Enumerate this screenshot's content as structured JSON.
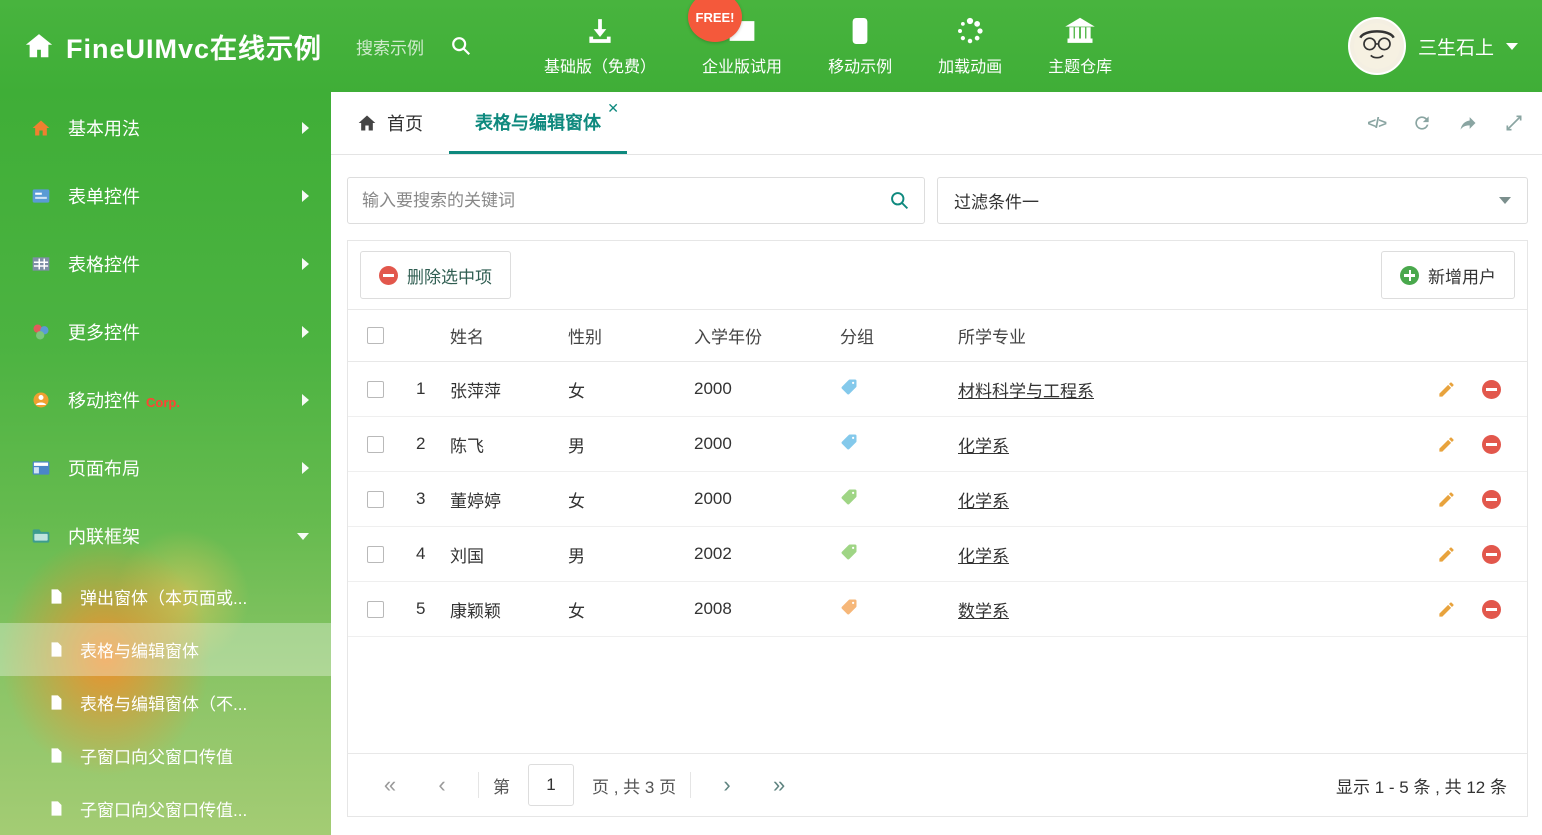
{
  "colors": {
    "brand_green": "#45b13a",
    "accent_teal": "#0e897e",
    "free_badge": "#f4593b"
  },
  "header": {
    "title": "FineUIMvc在线示例",
    "search_placeholder": "搜索示例",
    "free_badge": "FREE!",
    "nav_items": [
      {
        "label": "基础版（免费）",
        "icon": "download-icon"
      },
      {
        "label": "企业版试用",
        "icon": "mail-icon"
      },
      {
        "label": "移动示例",
        "icon": "mobile-icon"
      },
      {
        "label": "加载动画",
        "icon": "spinner-icon"
      },
      {
        "label": "主题仓库",
        "icon": "bank-icon"
      }
    ],
    "user": {
      "name": "三生石上"
    }
  },
  "sidebar": {
    "items": [
      {
        "label": "基本用法"
      },
      {
        "label": "表单控件"
      },
      {
        "label": "表格控件"
      },
      {
        "label": "更多控件"
      },
      {
        "label": "移动控件",
        "badge": "Corp."
      },
      {
        "label": "页面布局"
      },
      {
        "label": "内联框架"
      }
    ],
    "subitems": [
      {
        "label": "弹出窗体（本页面或..."
      },
      {
        "label": "表格与编辑窗体"
      },
      {
        "label": "表格与编辑窗体（不..."
      },
      {
        "label": "子窗口向父窗口传值"
      },
      {
        "label": "子窗口向父窗口传值..."
      }
    ]
  },
  "tabs": {
    "home": "首页",
    "active": "表格与编辑窗体",
    "close_glyph": "✕",
    "code_icon_glyph": "</>"
  },
  "filters": {
    "search_placeholder": "输入要搜索的关键词",
    "filter_dropdown": "过滤条件一"
  },
  "grid": {
    "delete_button": "删除选中项",
    "add_button": "新增用户",
    "columns": [
      "姓名",
      "性别",
      "入学年份",
      "分组",
      "所学专业"
    ],
    "rows": [
      {
        "num": "1",
        "name": "张萍萍",
        "gender": "女",
        "year": "2000",
        "tag_color": "#6fc0e8",
        "major": "材料科学与工程系"
      },
      {
        "num": "2",
        "name": "陈飞",
        "gender": "男",
        "year": "2000",
        "tag_color": "#6fc0e8",
        "major": "化学系"
      },
      {
        "num": "3",
        "name": "董婷婷",
        "gender": "女",
        "year": "2000",
        "tag_color": "#8fce70",
        "major": "化学系"
      },
      {
        "num": "4",
        "name": "刘国",
        "gender": "男",
        "year": "2002",
        "tag_color": "#8fce70",
        "major": "化学系"
      },
      {
        "num": "5",
        "name": "康颖颖",
        "gender": "女",
        "year": "2008",
        "tag_color": "#f5ab62",
        "major": "数学系"
      }
    ],
    "pagination": {
      "first_glyph": "«",
      "prev_glyph": "‹",
      "prefix": "第",
      "current_page": "1",
      "suffix": "页 , 共 3 页",
      "next_glyph": "›",
      "last_glyph": "»",
      "summary": "显示 1 - 5 条 , 共 12 条"
    }
  }
}
